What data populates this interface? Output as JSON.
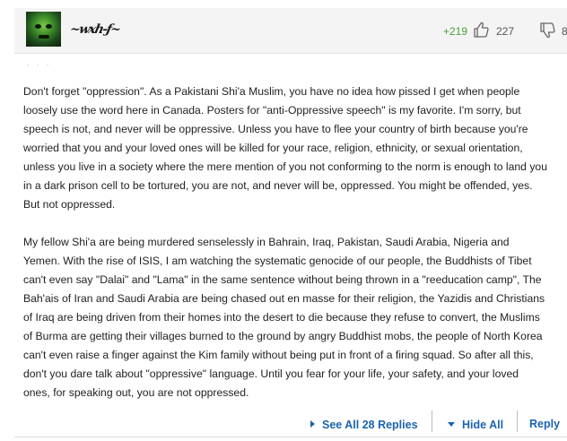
{
  "comment": {
    "username": "~wxh-ƒ~",
    "score": "+219",
    "likes": "227",
    "dislikes": "8",
    "paragraphs": [
      "Don't forget \"oppression\". As a Pakistani Shi'a Muslim, you have no idea how pissed I get when people loosely use the word here in Canada. Posters for \"anti-Oppressive speech\" is my favorite. I'm sorry, but speech is not, and never will be oppressive. Unless you have to flee your country of birth because you're worried that you and your loved ones will be killed for your race, religion, ethnicity, or sexual orientation, unless you live in a society where the mere mention of you not conforming to the norm is enough to land you in a dark prison cell to be tortured, you are not, and never will be, oppressed. You might be offended, yes. But not oppressed.",
      "My fellow Shi'a are being murdered senselessly in Bahrain, Iraq, Pakistan, Saudi Arabia, Nigeria and Yemen. With the rise of ISIS, I am watching the systematic genocide of our people, the Buddhists of Tibet can't even say \"Dalai\" and \"Lama\" in the same sentence without being thrown in a \"reeducation camp\", The Bah'ais of Iran and Saudi Arabia are being chased out en masse for their religion, the Yazidis and Christians of Iraq are being driven from their homes into the desert to die because they refuse to convert, the Muslims of Burma are getting their villages burned to the ground by angry Buddhist mobs, the people of North Korea can't even raise a finger against the Kim family without being put in front of a firing squad. So after all this, don't you dare talk about \"oppressive\" language. Until you fear for your life, your safety, and your loved ones, for speaking out, you are not oppressed."
    ]
  },
  "actions": {
    "see_all": "See All 28 Replies",
    "hide_all": "Hide All",
    "reply": "Reply"
  },
  "icons": {
    "thumb_up": "thumbs-up-icon",
    "thumb_down": "thumbs-down-icon",
    "see_all_arrow": "triangle-right-icon",
    "hide_all_arrow": "triangle-down-icon"
  },
  "colors": {
    "score": "#4a9e3a",
    "link": "#1b63b0",
    "header_bg": "#f4f4f4"
  }
}
